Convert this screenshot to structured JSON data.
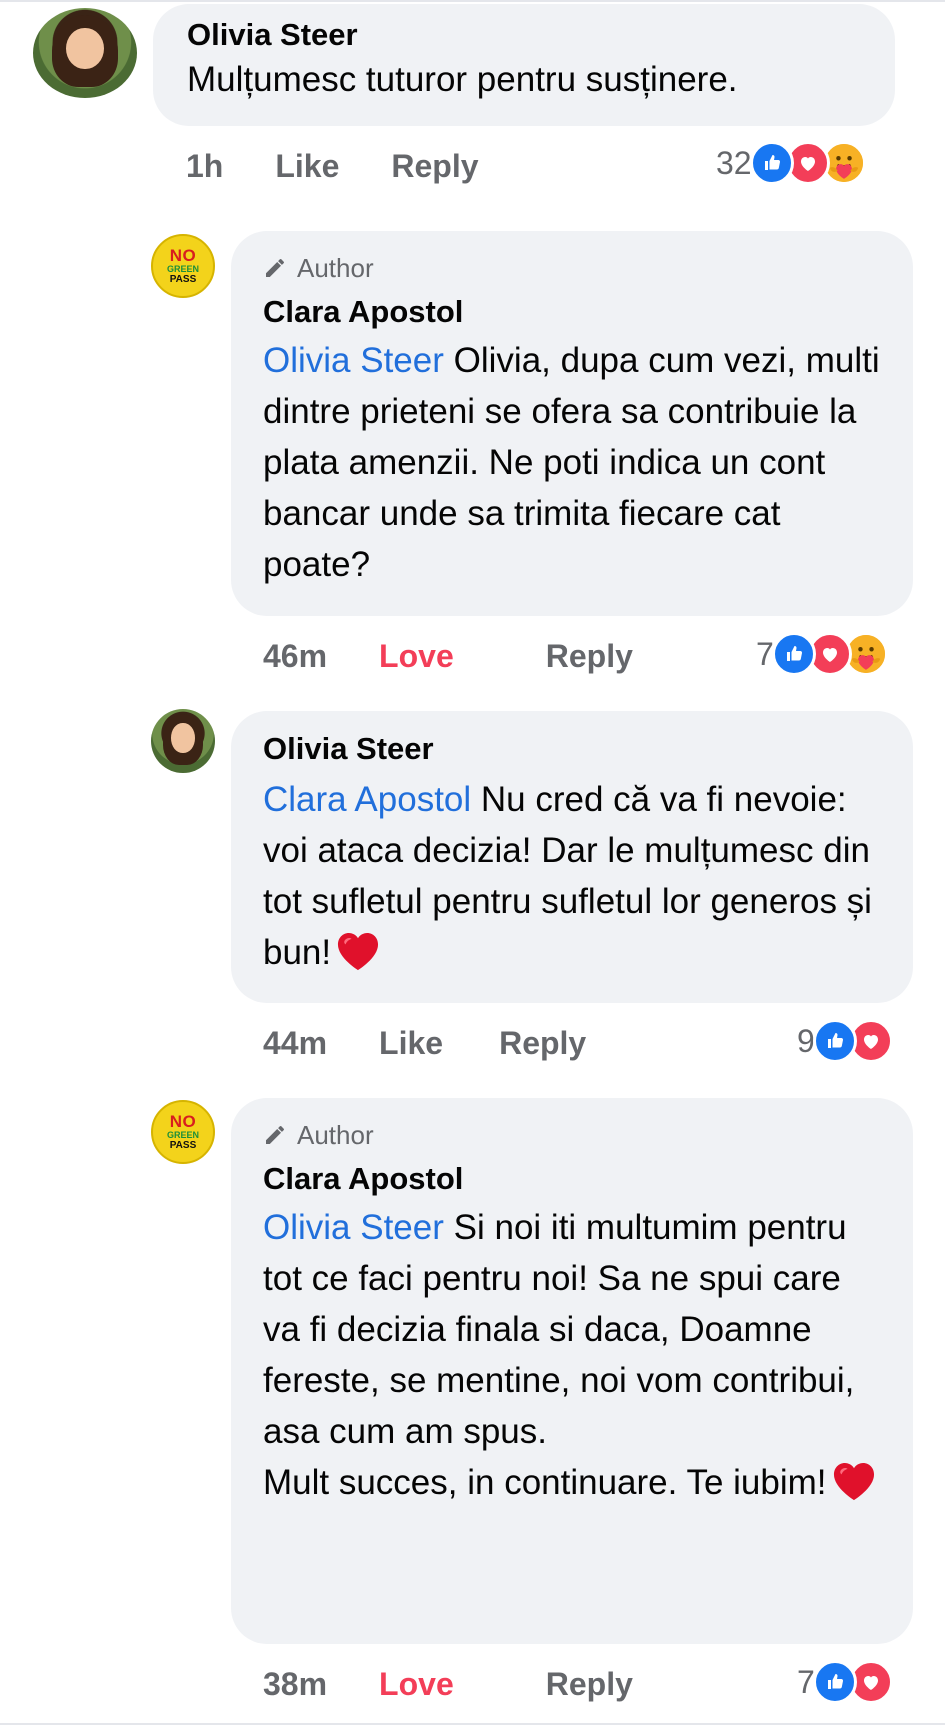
{
  "comments": [
    {
      "author": "Olivia Steer",
      "avatar": "profile-photo",
      "is_author": false,
      "mention": "",
      "text": "Mulțumesc tuturor pentru susținere.",
      "time": "1h",
      "reaction_label": "Like",
      "reply_label": "Reply",
      "reaction_count": "32",
      "reactions": [
        "like-icon",
        "love-icon",
        "care-icon"
      ]
    },
    {
      "author": "Clara Apostol",
      "avatar": "no-green-pass-badge",
      "is_author": true,
      "author_tag": "Author",
      "mention": "Olivia Steer",
      "text": "Olivia, dupa cum vezi, multi dintre prieteni se ofera sa contribuie la plata amenzii. Ne poti indica un cont bancar unde sa trimita fiecare cat poate?",
      "time": "46m",
      "reaction_label": "Love",
      "reply_label": "Reply",
      "reaction_count": "7",
      "reactions": [
        "like-icon",
        "love-icon",
        "care-icon"
      ]
    },
    {
      "author": "Olivia Steer",
      "avatar": "profile-photo",
      "is_author": false,
      "mention": "Clara Apostol",
      "text": "Nu cred că va fi nevoie: voi ataca decizia! Dar le mulțumesc din tot sufletul pentru sufletul lor generos și bun!",
      "emoji": "red-heart",
      "time": "44m",
      "reaction_label": "Like",
      "reply_label": "Reply",
      "reaction_count": "9",
      "reactions": [
        "like-icon",
        "love-icon"
      ]
    },
    {
      "author": "Clara Apostol",
      "avatar": "no-green-pass-badge",
      "is_author": true,
      "author_tag": "Author",
      "mention": "Olivia Steer",
      "text": "Si noi iti multumim pentru tot ce faci pentru noi! Sa ne spui care va fi decizia finala si daca, Doamne fereste, se mentine, noi vom contribui, asa cum am spus.",
      "text2": "Mult succes, in continuare. Te iubim!",
      "emoji": "red-heart",
      "time": "38m",
      "reaction_label": "Love",
      "reply_label": "Reply",
      "reaction_count": "7",
      "reactions": [
        "like-icon",
        "love-icon"
      ]
    }
  ],
  "badge": {
    "line1": "NO",
    "line2": "GREEN",
    "line3": "PASS"
  },
  "colors": {
    "mention": "#216fdb",
    "love_action": "#f33e58",
    "like_blue": "#1877f2",
    "bubble": "#f0f2f5",
    "meta": "#65676b"
  }
}
